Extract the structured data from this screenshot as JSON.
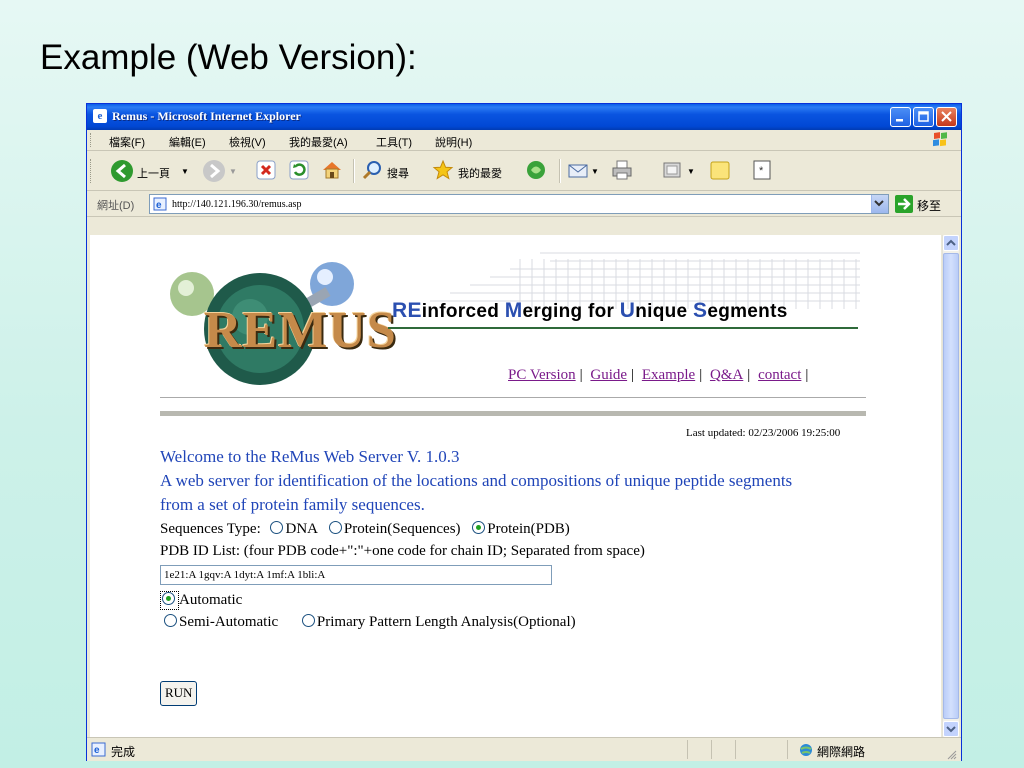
{
  "slide": {
    "title": "Example (Web Version):"
  },
  "window": {
    "title": "Remus - Microsoft Internet Explorer"
  },
  "menu": {
    "items": [
      "檔案(F)",
      "編輯(E)",
      "檢視(V)",
      "我的最愛(A)",
      "工具(T)",
      "說明(H)"
    ]
  },
  "toolbar": {
    "back_label": "上一頁",
    "search_label": "搜尋",
    "favorites_label": "我的最愛"
  },
  "address": {
    "label": "網址(D)",
    "url": "http://140.121.196.30/remus.asp",
    "go_label": "移至"
  },
  "page": {
    "logo_text": "REMUS",
    "heading": {
      "w1_cap": "RE",
      "w1_rest": "inforced",
      "w2_cap": "M",
      "w2_rest": "erging for",
      "w3_cap": "U",
      "w3_rest": "nique",
      "w4_cap": "S",
      "w4_rest": "egments"
    },
    "links": [
      "PC Version",
      "Guide",
      "Example",
      "Q&A",
      "contact"
    ],
    "last_updated": "Last updated: 02/23/2006 19:25:00",
    "welcome_lines": [
      "Welcome to the ReMus Web Server V. 1.0.3",
      "A web server for identification of the locations and compositions of unique peptide segments",
      "from a set of protein family sequences."
    ],
    "sequences_type_label": "Sequences Type:",
    "sequence_types": [
      "DNA",
      "Protein(Sequences)",
      "Protein(PDB)"
    ],
    "selected_sequence_type": "Protein(PDB)",
    "pdb_label": "PDB ID List: (four PDB code+\":\"+one code for chain ID; Separated from space)",
    "pdb_value": "1e21:A 1gqv:A 1dyt:A 1mf:A 1bli:A",
    "modes": [
      "Automatic",
      "Semi-Automatic",
      "Primary Pattern Length Analysis(Optional)"
    ],
    "selected_mode": "Automatic",
    "run_label": "RUN"
  },
  "status": {
    "left": "完成",
    "zone": "網際網路"
  }
}
